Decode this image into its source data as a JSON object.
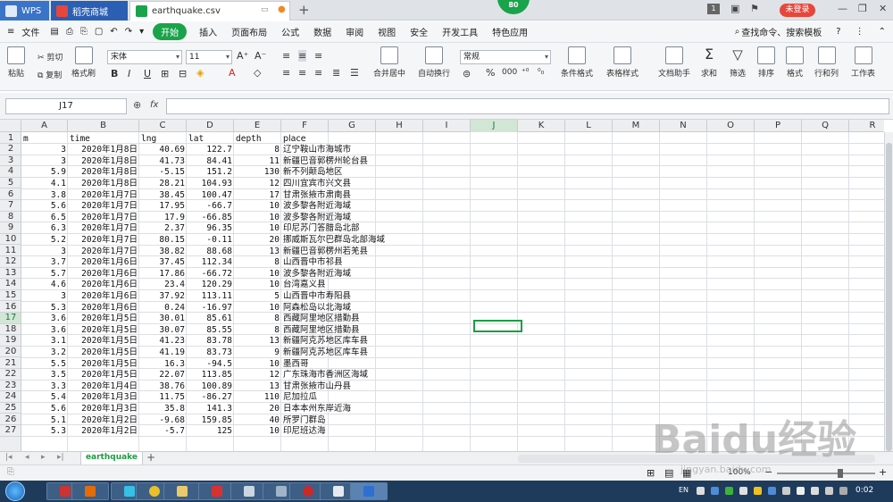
{
  "title_bar": {
    "tabs": [
      "WPS",
      "稻壳商城",
      "earthquake.csv"
    ],
    "badge": "80",
    "page_indicator": "1",
    "login_label": "未登录"
  },
  "menu": {
    "file_label": "文件",
    "start_label": "开始",
    "items": [
      "插入",
      "页面布局",
      "公式",
      "数据",
      "审阅",
      "视图",
      "安全",
      "开发工具",
      "特色应用"
    ],
    "search_label": "查找命令、搜索模板",
    "help_label": "?"
  },
  "ribbon": {
    "paste": "粘贴",
    "cut": "剪切",
    "copy": "复制",
    "format_painter": "格式刷",
    "font_name": "宋体",
    "font_size": "11",
    "merge_center": "合并居中",
    "wrap_text": "自动换行",
    "number_format": "常规",
    "conditional_format": "条件格式",
    "table_style": "表格样式",
    "doc_assistant": "文档助手",
    "sum": "求和",
    "filter": "筛选",
    "sort": "排序",
    "format": "格式",
    "row_col": "行和列",
    "worksheet": "工作表",
    "bold": "B",
    "italic": "I",
    "underline": "U",
    "percent": "%"
  },
  "formula_bar": {
    "name_box": "J17",
    "fx": "fx"
  },
  "columns": [
    "A",
    "B",
    "C",
    "D",
    "E",
    "F",
    "G",
    "H",
    "I",
    "J",
    "K",
    "L",
    "M",
    "N",
    "O",
    "P",
    "Q",
    "R"
  ],
  "selected_column": "J",
  "selected_row": "17",
  "rows": [
    {
      "n": "1",
      "A": "m",
      "B": "time",
      "C": "lng",
      "D": "lat",
      "E": "depth",
      "F": "place"
    },
    {
      "n": "2",
      "A": "3",
      "B": "2020年1月8日",
      "C": "40.69",
      "D": "122.7",
      "E": "8",
      "F": "辽宁鞍山市海城市"
    },
    {
      "n": "3",
      "A": "3",
      "B": "2020年1月8日",
      "C": "41.73",
      "D": "84.41",
      "E": "11",
      "F": "新疆巴音郭楞州轮台县"
    },
    {
      "n": "4",
      "A": "5.9",
      "B": "2020年1月8日",
      "C": "-5.15",
      "D": "151.2",
      "E": "130",
      "F": "新不列颠岛地区"
    },
    {
      "n": "5",
      "A": "4.1",
      "B": "2020年1月8日",
      "C": "28.21",
      "D": "104.93",
      "E": "12",
      "F": "四川宜宾市兴文县"
    },
    {
      "n": "6",
      "A": "3.8",
      "B": "2020年1月7日",
      "C": "38.45",
      "D": "100.47",
      "E": "17",
      "F": "甘肃张掖市肃南县"
    },
    {
      "n": "7",
      "A": "5.6",
      "B": "2020年1月7日",
      "C": "17.95",
      "D": "-66.7",
      "E": "10",
      "F": "波多黎各附近海域"
    },
    {
      "n": "8",
      "A": "6.5",
      "B": "2020年1月7日",
      "C": "17.9",
      "D": "-66.85",
      "E": "10",
      "F": "波多黎各附近海域"
    },
    {
      "n": "9",
      "A": "6.3",
      "B": "2020年1月7日",
      "C": "2.37",
      "D": "96.35",
      "E": "10",
      "F": "印尼苏门答腊岛北部"
    },
    {
      "n": "10",
      "A": "5.2",
      "B": "2020年1月7日",
      "C": "80.15",
      "D": "-0.11",
      "E": "20",
      "F": "挪威斯瓦尔巴群岛北部海域"
    },
    {
      "n": "11",
      "A": "3",
      "B": "2020年1月7日",
      "C": "38.82",
      "D": "88.68",
      "E": "13",
      "F": "新疆巴音郭楞州若羌县"
    },
    {
      "n": "12",
      "A": "3.7",
      "B": "2020年1月6日",
      "C": "37.45",
      "D": "112.34",
      "E": "8",
      "F": "山西晋中市祁县"
    },
    {
      "n": "13",
      "A": "5.7",
      "B": "2020年1月6日",
      "C": "17.86",
      "D": "-66.72",
      "E": "10",
      "F": "波多黎各附近海域"
    },
    {
      "n": "14",
      "A": "4.6",
      "B": "2020年1月6日",
      "C": "23.4",
      "D": "120.29",
      "E": "10",
      "F": "台湾嘉义县"
    },
    {
      "n": "15",
      "A": "3",
      "B": "2020年1月6日",
      "C": "37.92",
      "D": "113.11",
      "E": "5",
      "F": "山西晋中市寿阳县"
    },
    {
      "n": "16",
      "A": "5.3",
      "B": "2020年1月6日",
      "C": "0.24",
      "D": "-16.97",
      "E": "10",
      "F": "阿森松岛以北海域"
    },
    {
      "n": "17",
      "A": "3.6",
      "B": "2020年1月5日",
      "C": "30.01",
      "D": "85.61",
      "E": "8",
      "F": "西藏阿里地区措勤县"
    },
    {
      "n": "18",
      "A": "3.6",
      "B": "2020年1月5日",
      "C": "30.07",
      "D": "85.55",
      "E": "8",
      "F": "西藏阿里地区措勤县"
    },
    {
      "n": "19",
      "A": "3.1",
      "B": "2020年1月5日",
      "C": "41.23",
      "D": "83.78",
      "E": "13",
      "F": "新疆阿克苏地区库车县"
    },
    {
      "n": "20",
      "A": "3.2",
      "B": "2020年1月5日",
      "C": "41.19",
      "D": "83.73",
      "E": "9",
      "F": "新疆阿克苏地区库车县"
    },
    {
      "n": "21",
      "A": "5.5",
      "B": "2020年1月5日",
      "C": "16.3",
      "D": "-94.5",
      "E": "10",
      "F": "墨西哥"
    },
    {
      "n": "22",
      "A": "3.5",
      "B": "2020年1月5日",
      "C": "22.07",
      "D": "113.85",
      "E": "12",
      "F": "广东珠海市香洲区海域"
    },
    {
      "n": "23",
      "A": "3.3",
      "B": "2020年1月4日",
      "C": "38.76",
      "D": "100.89",
      "E": "13",
      "F": "甘肃张掖市山丹县"
    },
    {
      "n": "24",
      "A": "5.4",
      "B": "2020年1月3日",
      "C": "11.75",
      "D": "-86.27",
      "E": "110",
      "F": "尼加拉瓜"
    },
    {
      "n": "25",
      "A": "5.6",
      "B": "2020年1月3日",
      "C": "35.8",
      "D": "141.3",
      "E": "20",
      "F": "日本本州东岸近海"
    },
    {
      "n": "26",
      "A": "5.1",
      "B": "2020年1月2日",
      "C": "-9.68",
      "D": "159.85",
      "E": "40",
      "F": "所罗门群岛"
    },
    {
      "n": "27",
      "A": "5.3",
      "B": "2020年1月2日",
      "C": "-5.7",
      "D": "125",
      "E": "10",
      "F": "印尼班达海"
    }
  ],
  "sheet_tab": "earthquake",
  "add_sheet": "+",
  "status": {
    "zoom": "100%"
  },
  "taskbar": {
    "lang": "EN",
    "clock": "0:02"
  },
  "watermark": {
    "text": "Baidu经验",
    "url": "jingyan.baidu.com"
  }
}
